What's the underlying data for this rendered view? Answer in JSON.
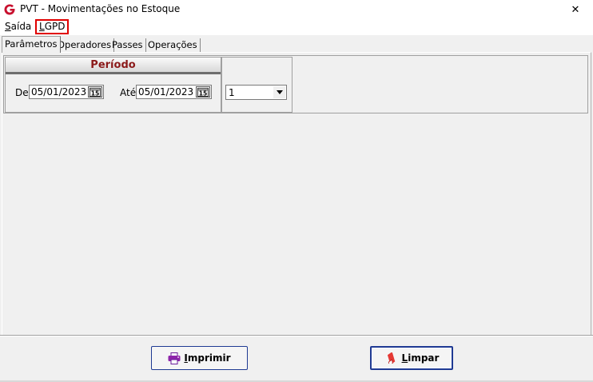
{
  "window": {
    "title": "PVT - Movimentações no Estoque",
    "app_icon": "g-logo-icon",
    "close_glyph": "✕"
  },
  "menu": {
    "saida_first": "S",
    "saida_rest": "aída",
    "lgpd_first": "L",
    "lgpd_rest": "GPD"
  },
  "tabs": [
    {
      "label": "Parâmetros",
      "active": true
    },
    {
      "label": "Operadores",
      "active": false
    },
    {
      "label": "Passes",
      "active": false
    },
    {
      "label": "Operações",
      "active": false
    }
  ],
  "periodo": {
    "title": "Período",
    "de_label": "De",
    "de_value": "05/01/2023",
    "ate_label": "Até",
    "ate_value": "05/01/2023",
    "calendar_day": "15"
  },
  "combo": {
    "value": "1"
  },
  "buttons": {
    "imprimir_first": "I",
    "imprimir_rest": "mprimir",
    "limpar_first": "L",
    "limpar_rest": "impar"
  },
  "colors": {
    "periodo_title": "#8b1a1a",
    "lgpd_highlight": "#e00000",
    "button_border": "#1f3a93"
  }
}
